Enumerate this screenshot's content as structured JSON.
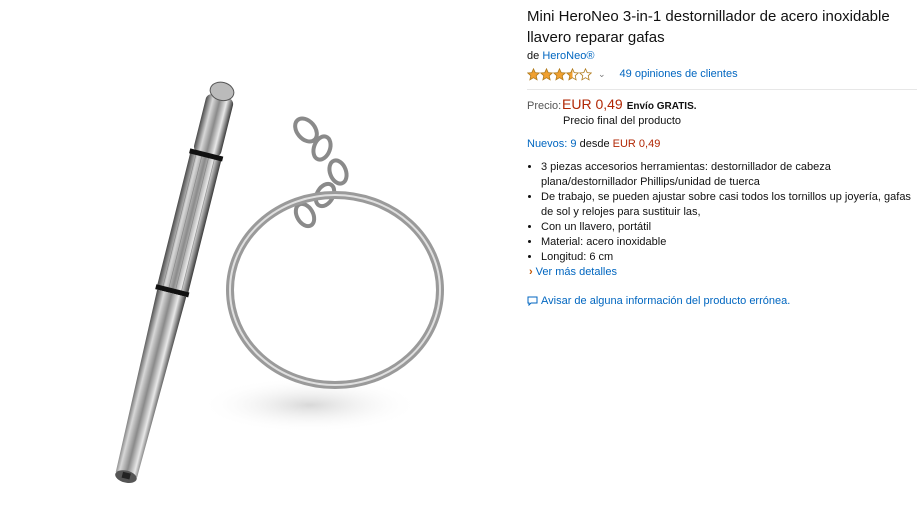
{
  "product": {
    "title": "Mini HeroNeo 3-in-1 destornillador de acero inoxidable llavero reparar gafas",
    "by_prefix": "de",
    "brand": "HeroNeo®",
    "rating": 3.5,
    "rating_max": 5,
    "reviews_text": "49 opiniones de clientes"
  },
  "pricing": {
    "label": "Precio:",
    "price": "EUR 0,49",
    "shipping": "Envío GRATIS.",
    "note": "Precio final del producto"
  },
  "offers": {
    "label": "Nuevos:",
    "count": "9",
    "from_text": "desde",
    "from_price": "EUR 0,49"
  },
  "bullets": [
    "3 piezas accesorios herramientas: destornillador de cabeza plana/destornillador Phillips/unidad de tuerca",
    "De trabajo, se pueden ajustar sobre casi todos los tornillos up joyería, gafas de sol y relojes para sustituir las,",
    "Con un llavero, portátil",
    "Material: acero inoxidable",
    "Longitud: 6 cm"
  ],
  "more_details": "Ver más detalles",
  "report_link": "Avisar de alguna información del producto errónea.",
  "colors": {
    "link": "#0066c0",
    "price": "#b12704",
    "star": "#f0a030",
    "more_arrow": "#c45500"
  }
}
